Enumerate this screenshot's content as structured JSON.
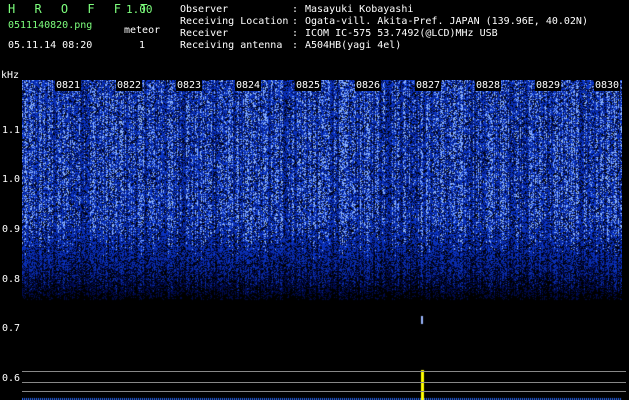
{
  "header": {
    "app_title": "H R O F F T",
    "app_version": "1.00",
    "file_name": "0511140820.png",
    "timestamp": "05.11.14 08:20",
    "meteor_label": "meteor",
    "meteor_count": "1"
  },
  "info": [
    {
      "label": "Observer",
      "value": "Masayuki Kobayashi"
    },
    {
      "label": "Receiving Location",
      "value": "Ogata-vill. Akita-Pref. JAPAN (139.96E, 40.02N)"
    },
    {
      "label": "Receiver",
      "value": "ICOM IC-575 53.7492(@LCD)MHz USB"
    },
    {
      "label": "Receiving antenna",
      "value": "A504HB(yagi 4el)"
    }
  ],
  "spectrogram": {
    "unit": "kHz",
    "y_ticks": [
      "1.1",
      "1.0",
      "0.9",
      "0.8",
      "0.7",
      "0.6"
    ],
    "x_ticks": [
      "0821",
      "0822",
      "0823",
      "0824",
      "0825",
      "0826",
      "0827",
      "0828",
      "0829",
      "0830"
    ],
    "colors": {
      "noise": "#1a3fd6",
      "bright": "#a8c8ff",
      "meteor": "#ffff00"
    }
  }
}
